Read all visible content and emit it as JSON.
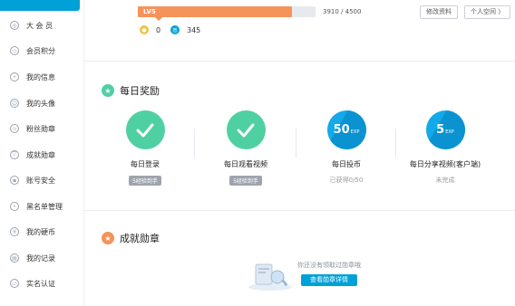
{
  "sidebar": {
    "items": [
      {
        "label": "大 会 员",
        "icon": "vip-icon"
      },
      {
        "label": "会员积分",
        "icon": "points-icon"
      },
      {
        "label": "我的信息",
        "icon": "user-icon"
      },
      {
        "label": "我的头像",
        "icon": "avatar-icon"
      },
      {
        "label": "粉丝勋章",
        "icon": "medal-icon"
      },
      {
        "label": "成就勋章",
        "icon": "shield-icon"
      },
      {
        "label": "账号安全",
        "icon": "lock-icon"
      },
      {
        "label": "黑名单管理",
        "icon": "blacklist-icon"
      },
      {
        "label": "我的硬币",
        "icon": "coin-icon"
      },
      {
        "label": "我的记录",
        "icon": "record-icon"
      },
      {
        "label": "实名认证",
        "icon": "id-card-icon"
      }
    ]
  },
  "level": {
    "badge": "LV5",
    "exp_current": 3910,
    "exp_max": 4500,
    "exp_text": "3910 / 4500",
    "progress_fraction": 0.8689
  },
  "buttons": {
    "edit_profile": "修改资料",
    "space": "个人空间 〉"
  },
  "coins": {
    "hard_coins": "0",
    "b_coins": "345"
  },
  "daily": {
    "title": "每日奖励",
    "rewards": [
      {
        "label": "每日登录",
        "tag": "5经验到手",
        "done": true
      },
      {
        "label": "每日观看视频",
        "tag": "5经验到手",
        "done": true
      },
      {
        "label": "每日投币",
        "value": "50",
        "exp": "EXP",
        "status": "已获得0/50"
      },
      {
        "label": "每日分享视频(客户端)",
        "value": "5",
        "exp": "EXP",
        "status": "未完成"
      }
    ]
  },
  "achievements": {
    "title": "成就勋章",
    "empty_text": "你还没有领取过勋章哦",
    "button": "查看勋章详情"
  },
  "colors": {
    "accent": "#00a1d6",
    "level_fill": "#f6935a",
    "green": "#4fd0a3",
    "blue": "#14a9e8"
  }
}
